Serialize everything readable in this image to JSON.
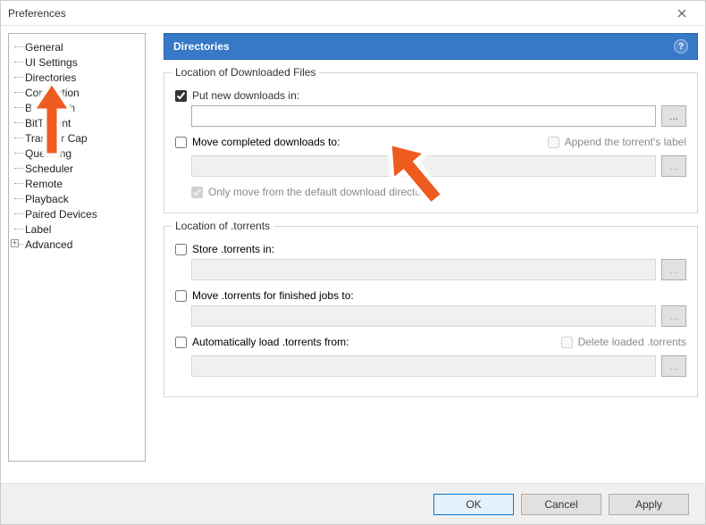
{
  "window": {
    "title": "Preferences"
  },
  "sidebar": {
    "items": [
      "General",
      "UI Settings",
      "Directories",
      "Connection",
      "Bandwidth",
      "BitTorrent",
      "Transfer Cap",
      "Queueing",
      "Scheduler",
      "Remote",
      "Playback",
      "Paired Devices",
      "Label",
      "Advanced"
    ],
    "selected_index": 2
  },
  "panel": {
    "title": "Directories",
    "group1": {
      "legend": "Location of Downloaded Files",
      "put_new": {
        "label": "Put new downloads in:",
        "checked": true,
        "path": ""
      },
      "move_completed": {
        "label": "Move completed downloads to:",
        "checked": false,
        "path": ""
      },
      "append_label": {
        "label": "Append the torrent's label",
        "checked": false
      },
      "only_move": {
        "label": "Only move from the default download directory",
        "checked": true
      }
    },
    "group2": {
      "legend": "Location of .torrents",
      "store": {
        "label": "Store .torrents in:",
        "checked": false,
        "path": ""
      },
      "move_finished": {
        "label": "Move .torrents for finished jobs to:",
        "checked": false,
        "path": ""
      },
      "auto_load": {
        "label": "Automatically load .torrents from:",
        "checked": false,
        "path": ""
      },
      "delete_loaded": {
        "label": "Delete loaded .torrents",
        "checked": false
      }
    }
  },
  "buttons": {
    "ok": "OK",
    "cancel": "Cancel",
    "apply": "Apply",
    "browse": "..."
  }
}
